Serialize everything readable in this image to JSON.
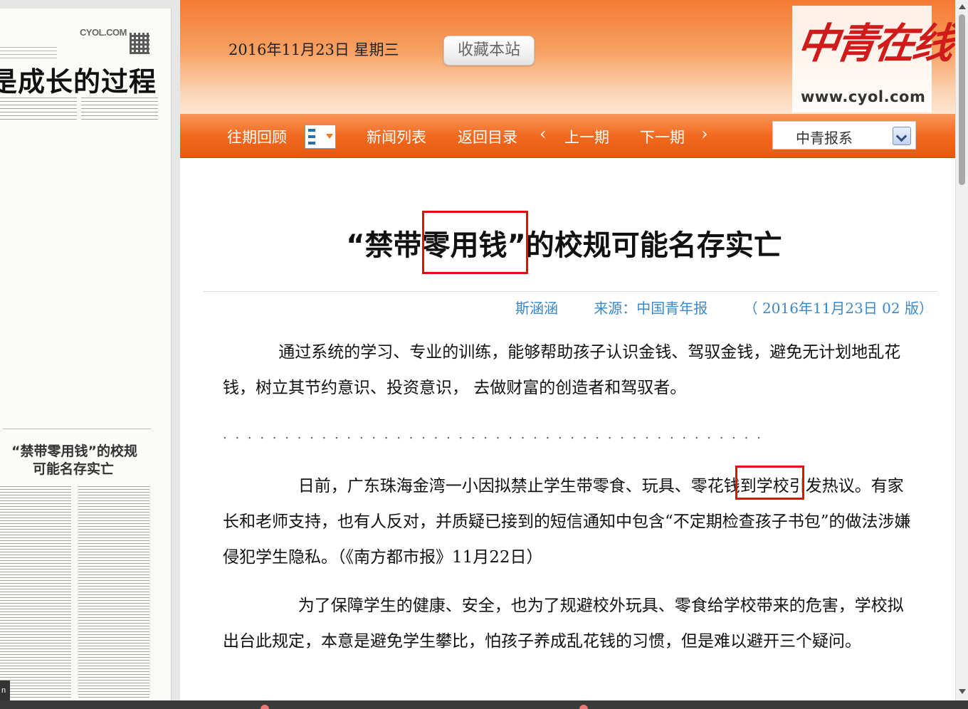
{
  "paper_thumbnail": {
    "brand": "CYOL.COM",
    "headline": "是成长的过程",
    "sub_headline_line1": "“禁带零用钱”的校规",
    "sub_headline_line2": "可能名存实亡",
    "badge": "n"
  },
  "header": {
    "date": "2016年11月23日  星期三",
    "bookmark_label": "收藏本站",
    "logo_text": "中青在线",
    "logo_url": "www.cyol.com"
  },
  "nav": {
    "archive": "往期回顾",
    "news_list": "新闻列表",
    "back_to_index": "返回目录",
    "prev_arrow": "‹",
    "prev_issue": "上一期",
    "next_issue": "下一期",
    "next_arrow": "›",
    "paper_select": "中青报系"
  },
  "article": {
    "title": "“禁带零用钱”的校规可能名存实亡",
    "author": "斯涵涵",
    "source": "来源：中国青年报",
    "date_edition": "（ 2016年11月23日    02  版）",
    "lead": "通过系统的学习、专业的训练，能够帮助孩子认识金钱、驾驭金钱，避免无计划地乱花钱，树立其节约意识、投资意识， 去做财富的创造者和驾驭者。",
    "divider": ". . . . . . . . . . . . . . . . . . . . . . . . . . . . . . . . . . . . . . . . . . . . . . . . . . . . . . . . . . . . . . . . . . . . . . . . . . . .",
    "paragraphs": [
      "日前，广东珠海金湾一小因拟禁止学生带零食、玩具、零花钱到学校引发热议。有家长和老师支持，也有人反对，并质疑已接到的短信通知中包含“不定期检查孩子书包”的做法涉嫌侵犯学生隐私。（《南方都市报》11月22日）",
      "为了保障学生的健康、安全，也为了规避校外玩具、零食给学校带来的危害，学校拟出台此规定，本意是避免学生攀比，怕孩子养成乱花钱的习惯，但是难以避开三个疑问。"
    ]
  },
  "colors": {
    "accent_orange": "#f26a20",
    "meta_blue": "#3a88c8",
    "highlight_red": "#e01010",
    "logo_red": "#d01b1b"
  },
  "icons": {
    "calendar": "calendar-icon",
    "dropdown": "chevron-down-icon",
    "qr": "qr-code-icon"
  }
}
